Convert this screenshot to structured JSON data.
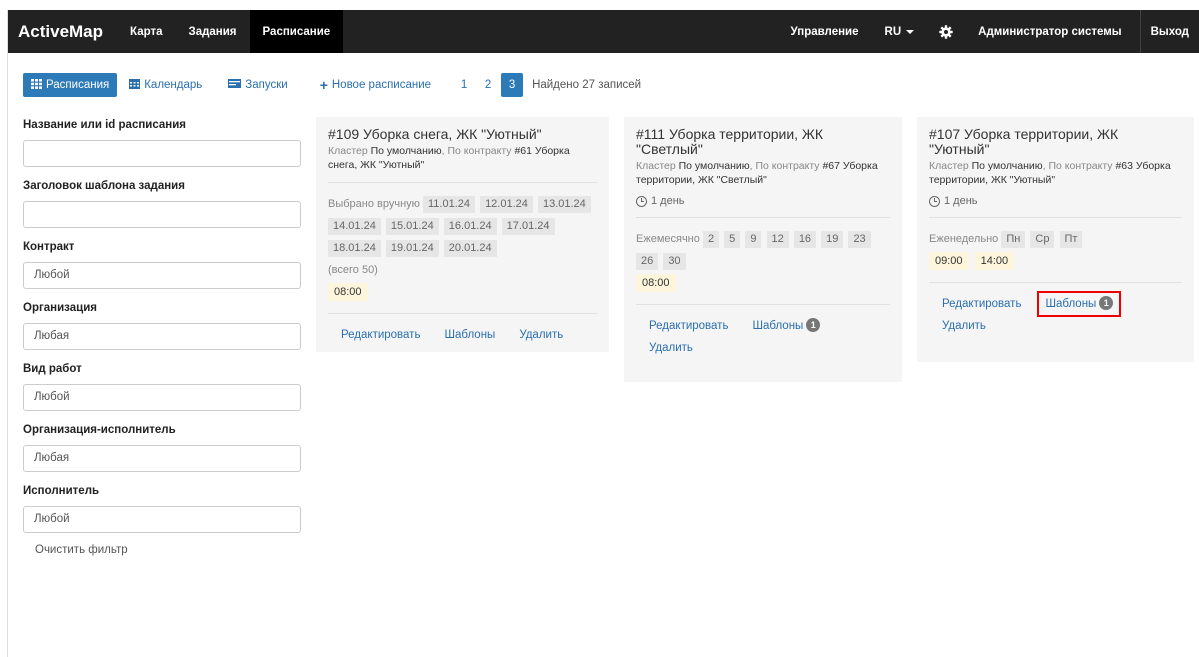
{
  "nav": {
    "brand": "ActiveMap",
    "items": [
      "Карта",
      "Задания",
      "Расписание"
    ],
    "manage": "Управление",
    "lang": "RU",
    "user": "Администратор системы",
    "logout": "Выход"
  },
  "toolbar": {
    "schedules": "Расписания",
    "calendar": "Календарь",
    "launches": "Запуски",
    "new_schedule": "Новое расписание",
    "pages": [
      "1",
      "2",
      "3"
    ],
    "found": "Найдено 27 записей"
  },
  "filters": {
    "name_label": "Название или id расписания",
    "name_value": "",
    "template_label": "Заголовок шаблона задания",
    "template_value": "",
    "contract_label": "Контракт",
    "contract_value": "Любой",
    "org_label": "Организация",
    "org_value": "Любая",
    "worktype_label": "Вид работ",
    "worktype_value": "Любой",
    "exec_org_label": "Организация-исполнитель",
    "exec_org_value": "Любая",
    "executor_label": "Исполнитель",
    "executor_value": "Любой",
    "clear": "Очистить фильтр"
  },
  "cards": [
    {
      "id": "#109",
      "title": "Уборка снега, ЖК \"Уютный\"",
      "cluster_label": "Кластер",
      "cluster_value": "По умолчанию",
      "contract_label": ", По контракту",
      "contract_id": "#61",
      "contract_name": "Уборка снега, ЖК \"Уютный\"",
      "sched_label": "Выбрано вручную",
      "dates": [
        "11.01.24",
        "12.01.24",
        "13.01.24",
        "14.01.24",
        "15.01.24",
        "16.01.24",
        "17.01.24",
        "18.01.24",
        "19.01.24",
        "20.01.24"
      ],
      "total": "(всего 50)",
      "times": [
        "08:00"
      ],
      "edit": "Редактировать",
      "templates": "Шаблоны",
      "delete": "Удалить"
    },
    {
      "id": "#111",
      "title": "Уборка территории, ЖК \"Светлый\"",
      "cluster_label": "Кластер",
      "cluster_value": "По умолчанию",
      "contract_label": ", По контракту",
      "contract_id": "#67",
      "contract_name": "Уборка территории, ЖК \"Светлый\"",
      "duration": "1 день",
      "sched_label": "Ежемесячно",
      "days": [
        "2",
        "5",
        "9",
        "12",
        "16",
        "19",
        "23",
        "26",
        "30"
      ],
      "times": [
        "08:00"
      ],
      "edit": "Редактировать",
      "templates": "Шаблоны",
      "templates_count": "1",
      "delete": "Удалить"
    },
    {
      "id": "#107",
      "title": "Уборка территории, ЖК \"Уютный\"",
      "cluster_label": "Кластер",
      "cluster_value": "По умолчанию",
      "contract_label": ", По контракту",
      "contract_id": "#63",
      "contract_name": "Уборка территории, ЖК \"Уютный\"",
      "duration": "1 день",
      "sched_label": "Еженедельно",
      "weekdays": [
        "Пн",
        "Ср",
        "Пт"
      ],
      "times": [
        "09:00",
        "14:00"
      ],
      "edit": "Редактировать",
      "templates": "Шаблоны",
      "templates_count": "1",
      "delete": "Удалить"
    }
  ]
}
